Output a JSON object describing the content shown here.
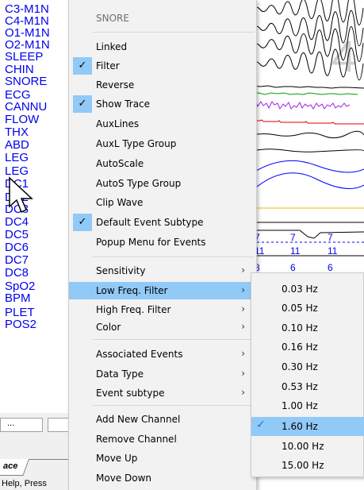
{
  "channels": [
    "C3-M1N",
    "C4-M1N",
    "O1-M1N",
    "O2-M1N",
    "SLEEP",
    "CHIN",
    "SNORE",
    "ECG",
    "CANNU",
    "FLOW",
    "THX",
    "ABD",
    "LEG",
    "LEG",
    "DC1",
    "DC2",
    "DC3",
    "DC4",
    "DC5",
    "DC6",
    "DC7",
    "DC8",
    "SpO2",
    "BPM",
    "PLET",
    "POS2"
  ],
  "menu": {
    "header": "SNORE",
    "group1": [
      {
        "label": "Linked",
        "checked": false
      },
      {
        "label": "Filter",
        "checked": true
      },
      {
        "label": "Reverse",
        "checked": false
      },
      {
        "label": "Show Trace",
        "checked": true
      },
      {
        "label": "AuxLines",
        "checked": false
      },
      {
        "label": "AuxL Type Group",
        "checked": false
      },
      {
        "label": "AutoScale",
        "checked": false
      },
      {
        "label": "AutoS Type Group",
        "checked": false
      },
      {
        "label": "Clip Wave",
        "checked": false
      },
      {
        "label": "Default Event Subtype",
        "checked": true
      },
      {
        "label": "Popup Menu for Events",
        "checked": false
      }
    ],
    "group2": [
      {
        "label": "Sensitivity"
      },
      {
        "label": "Low Freq. Filter"
      },
      {
        "label": "High Freq. Filter"
      },
      {
        "label": "Color"
      }
    ],
    "group3": [
      {
        "label": "Associated Events"
      },
      {
        "label": "Data Type"
      },
      {
        "label": "Event subtype"
      }
    ],
    "group4": [
      {
        "label": "Add New Channel"
      },
      {
        "label": "Remove Channel"
      },
      {
        "label": "Move Up"
      },
      {
        "label": "Move Down"
      }
    ],
    "highlighted": "Low Freq. Filter",
    "submenu_arrow": "›",
    "checkmark": "✓"
  },
  "submenu": {
    "items": [
      "0.03 Hz",
      "0.05 Hz",
      "0.10 Hz",
      "0.16 Hz",
      "0.30 Hz",
      "0.53 Hz",
      "1.00 Hz",
      "1.60 Hz",
      "10.00 Hz",
      "15.00 Hz"
    ],
    "selected": "1.60 Hz"
  },
  "trace_annotations": {
    "watermark": "4",
    "row1": [
      "7",
      "7",
      "7"
    ],
    "row2": [
      "11",
      "11",
      "11"
    ],
    "row3": [
      "8",
      "6",
      "6"
    ]
  },
  "bottom": {
    "tab_label": "ace",
    "field": "...",
    "status": "Help, Press"
  },
  "colors": {
    "channel_label": "#0000ee",
    "menu_bg": "#f2f2f2",
    "highlight": "#91c9f7",
    "trace_green": "#00a000",
    "trace_purple": "#a020f0",
    "trace_red": "#e00000",
    "trace_blue": "#0000ff",
    "trace_yellow": "#e0c000"
  },
  "icons": {
    "cursor": "arrow-cursor-icon",
    "check": "checkmark-icon",
    "arrow": "chevron-right-icon"
  }
}
